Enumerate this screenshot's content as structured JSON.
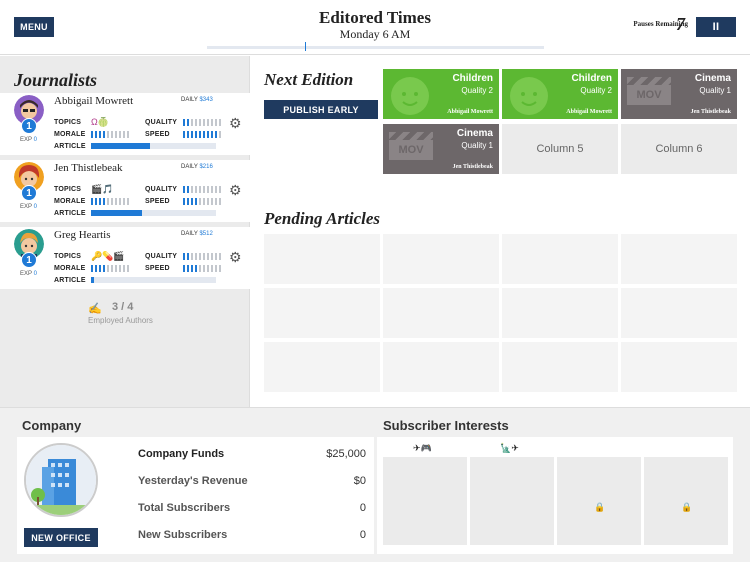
{
  "header": {
    "menu_label": "MENU",
    "title": "Editored Times",
    "datetime": "Monday  6 AM",
    "pauses_label": "Pauses Remaining",
    "pauses_count": "7",
    "pause_label": "II",
    "timeline_progress": 0.29
  },
  "journalists": {
    "title": "Journalists",
    "employed": "3 / 4",
    "employed_label": "Employed Authors",
    "labels": {
      "topics": "TOPICS",
      "morale": "MORALE",
      "article": "ARTICLE",
      "quality": "QUALITY",
      "speed": "SPEED",
      "daily": "DAILY",
      "exp": "EXP"
    },
    "items": [
      {
        "name": "Abbigail Mowrett",
        "daily": "$343",
        "level": "1",
        "exp": "0",
        "topics": "Ω🍈",
        "morale": 0.35,
        "quality": 0.15,
        "speed": 0.9,
        "article": 0.47
      },
      {
        "name": "Jen Thistlebeak",
        "daily": "$216",
        "level": "1",
        "exp": "0",
        "topics": "🎬🎵",
        "morale": 0.35,
        "quality": 0.15,
        "speed": 0.4,
        "article": 0.41
      },
      {
        "name": "Greg Heartis",
        "daily": "$512",
        "level": "1",
        "exp": "0",
        "topics": "🔑💊🎬",
        "morale": 0.35,
        "quality": 0.15,
        "speed": 0.4,
        "article": 0.02
      }
    ]
  },
  "next_edition": {
    "title": "Next Edition",
    "publish_label": "PUBLISH EARLY",
    "slots": [
      {
        "category": "Children",
        "quality": "Quality 2",
        "author": "Abbigail Mowrett",
        "kind": "children"
      },
      {
        "category": "Children",
        "quality": "Quality 2",
        "author": "Abbigail Mowrett",
        "kind": "children"
      },
      {
        "category": "Cinema",
        "quality": "Quality 1",
        "author": "Jen Thistlebeak",
        "kind": "cinema"
      },
      {
        "category": "Cinema",
        "quality": "Quality 1",
        "author": "Jen Thistlebeak",
        "kind": "cinema"
      },
      {
        "column": "Column 5",
        "kind": "empty"
      },
      {
        "column": "Column 6",
        "kind": "empty"
      }
    ],
    "mov_label": "MOV"
  },
  "pending": {
    "title": "Pending Articles"
  },
  "company": {
    "title": "Company",
    "new_office_label": "NEW OFFICE",
    "rows": [
      {
        "label": "Company Funds",
        "value": "$25,000"
      },
      {
        "label": "Yesterday's Revenue",
        "value": "$0"
      },
      {
        "label": "Total Subscribers",
        "value": "0"
      },
      {
        "label": "New Subscribers",
        "value": "0"
      }
    ]
  },
  "subscribers": {
    "title": "Subscriber Interests",
    "col1_icons": "✈🎮",
    "col2_icons": "🗽✈",
    "lock_icon": "🔒"
  },
  "colors": {
    "navy": "#1f3a5f",
    "accent": "#1f7ad6",
    "children": "#5cb832",
    "cinema": "#6d6769"
  }
}
